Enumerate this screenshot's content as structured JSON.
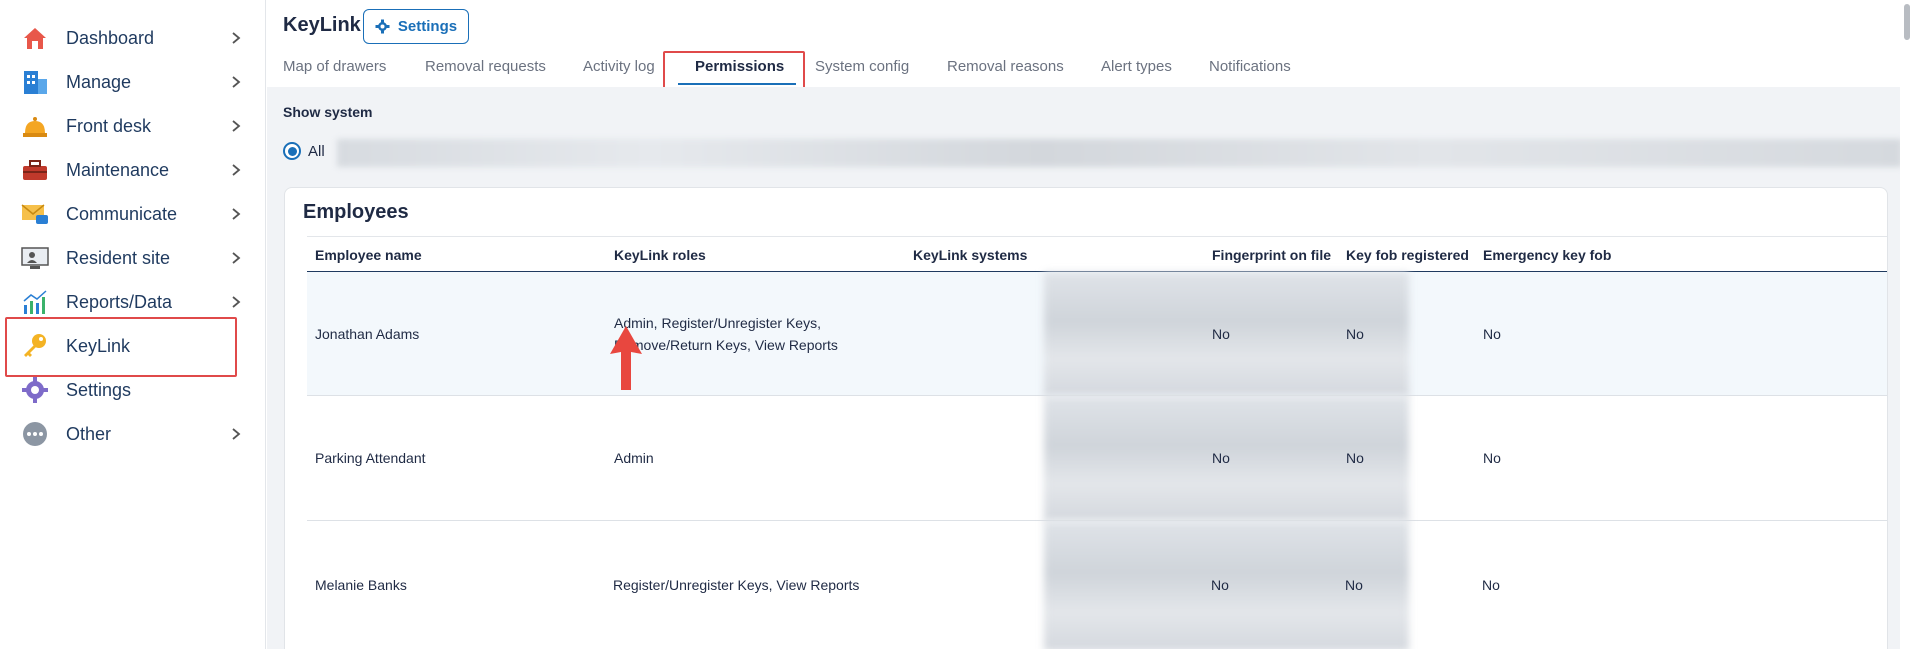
{
  "sidebar": {
    "items": [
      {
        "label": "Dashboard",
        "icon": "house-icon",
        "chevron": true
      },
      {
        "label": "Manage",
        "icon": "building-icon",
        "chevron": true
      },
      {
        "label": "Front desk",
        "icon": "bell-icon",
        "chevron": true
      },
      {
        "label": "Maintenance",
        "icon": "toolbox-icon",
        "chevron": true
      },
      {
        "label": "Communicate",
        "icon": "envelope-icon",
        "chevron": true
      },
      {
        "label": "Resident site",
        "icon": "monitor-user-icon",
        "chevron": true
      },
      {
        "label": "Reports/Data",
        "icon": "chart-icon",
        "chevron": true
      },
      {
        "label": "KeyLink",
        "icon": "key-icon",
        "chevron": false
      },
      {
        "label": "Settings",
        "icon": "gear-icon",
        "chevron": false
      },
      {
        "label": "Other",
        "icon": "more-icon",
        "chevron": true
      }
    ]
  },
  "header": {
    "title": "KeyLink",
    "settings_label": "Settings"
  },
  "tabs": [
    {
      "label": "Map of drawers"
    },
    {
      "label": "Removal requests"
    },
    {
      "label": "Activity log"
    },
    {
      "label": "Permissions",
      "active": true
    },
    {
      "label": "System config"
    },
    {
      "label": "Removal reasons"
    },
    {
      "label": "Alert types"
    },
    {
      "label": "Notifications"
    }
  ],
  "filters": {
    "show_system_label": "Show system",
    "all_label": "All"
  },
  "employees": {
    "title": "Employees",
    "columns": [
      "Employee name",
      "KeyLink roles",
      "KeyLink systems",
      "Fingerprint on file",
      "Key fob registered",
      "Emergency key fob"
    ],
    "rows": [
      {
        "name": "Jonathan Adams",
        "roles": "Admin, Register/Unregister Keys, Remove/Return Keys, View Reports",
        "fingerprint": "No",
        "fob": "No",
        "emergency": "No"
      },
      {
        "name": "Parking Attendant",
        "roles": "Admin",
        "fingerprint": "No",
        "fob": "No",
        "emergency": "No"
      },
      {
        "name": "Melanie Banks",
        "roles": "Register/Unregister Keys, View Reports",
        "fingerprint": "No",
        "fob": "No",
        "emergency": "No"
      }
    ]
  },
  "colors": {
    "accent": "#1a6fb8",
    "highlight": "#e04a4a"
  }
}
